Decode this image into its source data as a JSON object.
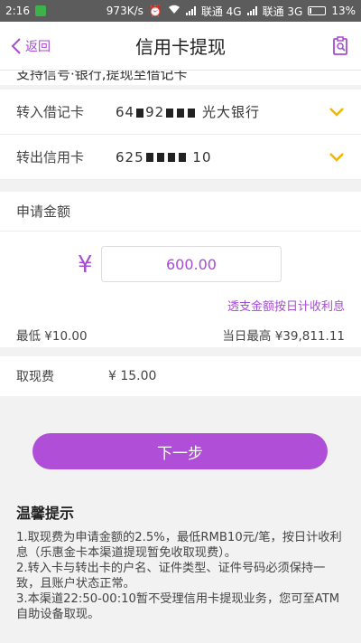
{
  "status_bar": {
    "time": "2:16",
    "speed": "973K/s",
    "carrier1": "联通 4G",
    "carrier2": "联通 3G",
    "battery": "13%",
    "battery_level": 0.13
  },
  "navbar": {
    "back_label": "返回",
    "title": "信用卡提现",
    "accent_color": "#a84bd6"
  },
  "cutoff_text": "支持信号·银行,提现至借记卡",
  "cards": {
    "debit": {
      "label": "转入借记卡",
      "value_start": "64",
      "value_mid": "92",
      "value_end": "光大银行"
    },
    "credit": {
      "label": "转出信用卡",
      "value_start": "625",
      "value_end": "10"
    }
  },
  "amount": {
    "section_label": "申请金额",
    "currency_symbol": "¥",
    "value": "600.00",
    "interest_link": "透支金额按日计收利息",
    "min_label": "最低 ¥10.00",
    "max_label": "当日最高 ¥39,811.11"
  },
  "fee": {
    "label": "取现费",
    "value": "¥ 15.00"
  },
  "next_button": "下一步",
  "tips": {
    "title": "温馨提示",
    "items": [
      "1.取现费为申请金额的2.5%，最低RMB10元/笔，按日计收利息（乐惠金卡本渠道提现暂免收取现费）。",
      "2.转入卡与转出卡的户名、证件类型、证件号码必须保持一致，且账户状态正常。",
      "3.本渠道22:50-00:10暂不受理信用卡提现业务，您可至ATM自助设备取现。"
    ]
  }
}
